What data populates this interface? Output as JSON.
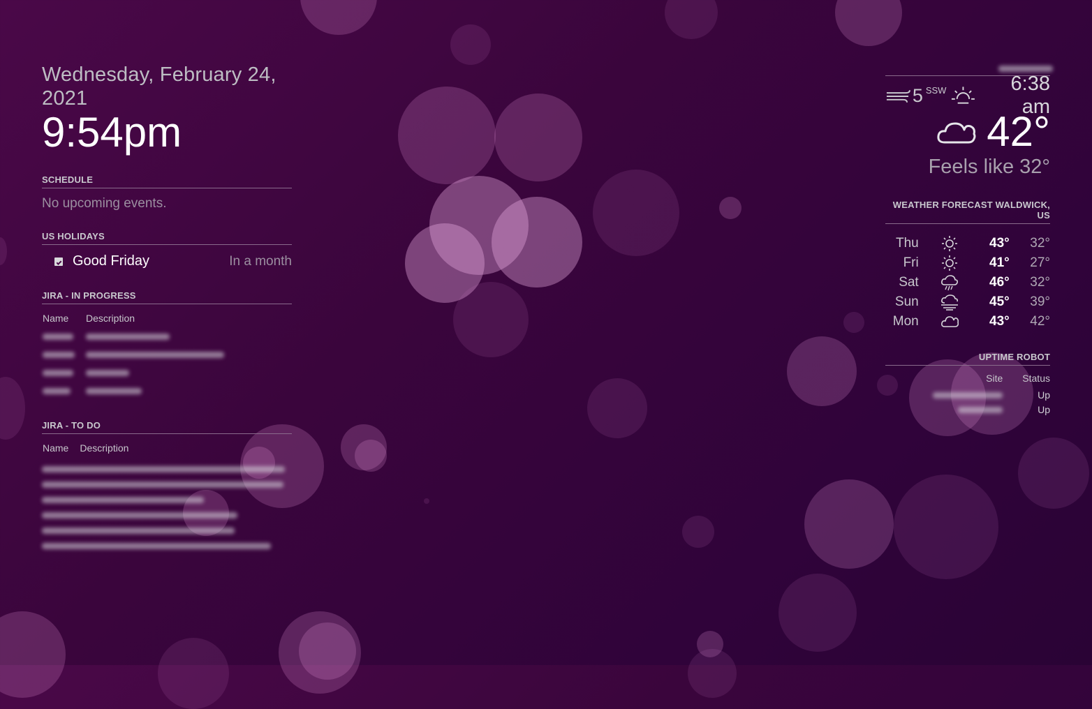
{
  "clock": {
    "date": "Wednesday, February 24, 2021",
    "time": "9:54pm"
  },
  "schedule": {
    "header": "SCHEDULE",
    "empty_text": "No upcoming events."
  },
  "holidays": {
    "header": "US HOLIDAYS",
    "events": [
      {
        "name": "Good Friday",
        "when": "In a month",
        "icon": "calendar-check-icon"
      }
    ]
  },
  "jira_in_progress": {
    "header": "JIRA - IN PROGRESS",
    "columns": [
      "Name",
      "Description"
    ]
  },
  "jira_to_do": {
    "header": "JIRA - TO DO",
    "columns": [
      "Name",
      "Description"
    ]
  },
  "current_weather": {
    "wind_speed": "5",
    "wind_direction": "SSW",
    "sunrise": "6:38 am",
    "temperature": "42°",
    "feels_like": "Feels like 32°",
    "condition_icon": "cloudy-icon"
  },
  "forecast": {
    "header": "WEATHER FORECAST WALDWICK, US",
    "days": [
      {
        "day": "Thu",
        "icon": "sunny-icon",
        "high": "43°",
        "low": "32°"
      },
      {
        "day": "Fri",
        "icon": "sunny-icon",
        "high": "41°",
        "low": "27°"
      },
      {
        "day": "Sat",
        "icon": "rain-icon",
        "high": "46°",
        "low": "32°"
      },
      {
        "day": "Sun",
        "icon": "fog-icon",
        "high": "45°",
        "low": "39°"
      },
      {
        "day": "Mon",
        "icon": "cloudy-icon",
        "high": "43°",
        "low": "42°"
      }
    ]
  },
  "uptime": {
    "header": "UPTIME ROBOT",
    "columns": [
      "Site",
      "Status"
    ],
    "rows": [
      {
        "status": "Up"
      },
      {
        "status": "Up"
      }
    ]
  },
  "colors": {
    "background": "#3a053c",
    "text": "#b9b9bd",
    "bright_text": "#ffffff"
  }
}
